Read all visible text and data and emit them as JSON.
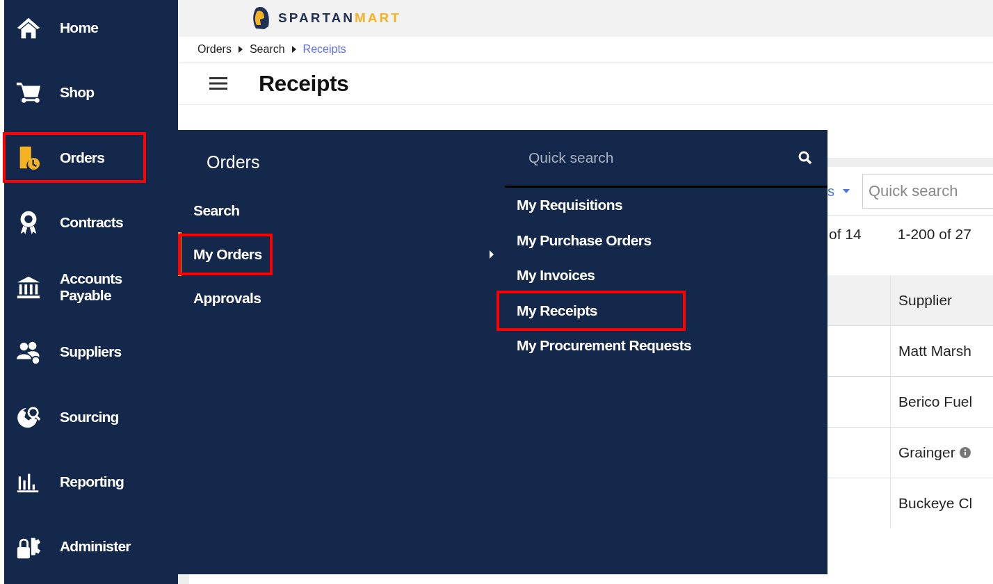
{
  "sidebar": {
    "items": [
      {
        "kind": "home",
        "label": "Home",
        "selected": false,
        "annotated": false
      },
      {
        "kind": "cart",
        "label": "Shop",
        "selected": false,
        "annotated": false
      },
      {
        "kind": "orders",
        "label": "Orders",
        "selected": true,
        "annotated": true
      },
      {
        "kind": "award",
        "label": "Contracts",
        "selected": false,
        "annotated": false
      },
      {
        "kind": "bank",
        "label": "Accounts Payable",
        "selected": false,
        "annotated": false
      },
      {
        "kind": "people",
        "label": "Suppliers",
        "selected": false,
        "annotated": false
      },
      {
        "kind": "globe",
        "label": "Sourcing",
        "selected": false,
        "annotated": false
      },
      {
        "kind": "chart",
        "label": "Reporting",
        "selected": false,
        "annotated": false
      },
      {
        "kind": "lock",
        "label": "Administer",
        "selected": false,
        "annotated": false
      }
    ]
  },
  "logo": {
    "name": "SPARTAN",
    "accent": "MART"
  },
  "breadcrumb": [
    {
      "label": "Orders",
      "current": false
    },
    {
      "label": "Search",
      "current": false
    },
    {
      "label": "Receipts",
      "current": true
    }
  ],
  "page_title": "Receipts",
  "toolbar": {
    "dropdown": "s",
    "search": {
      "placeholder": "Quick search"
    }
  },
  "counts": {
    "pages": "of 14",
    "range": "1-200 of 27"
  },
  "table": {
    "columns": [
      "Supplier"
    ],
    "rows": [
      {
        "supplier": "Matt Marsh",
        "info": false
      },
      {
        "supplier": "Berico Fuel",
        "info": false
      },
      {
        "supplier": "Grainger",
        "info": true
      },
      {
        "supplier": "Buckeye Cl",
        "info": false
      }
    ]
  },
  "flyout": {
    "title": "Orders",
    "items": [
      {
        "label": "Search",
        "selected": false,
        "annotated": false
      },
      {
        "label": "My Orders",
        "selected": true,
        "annotated": true
      },
      {
        "label": "Approvals",
        "selected": false,
        "annotated": false
      }
    ],
    "search": {
      "placeholder": "Quick search"
    },
    "subitems": [
      {
        "label": "My Requisitions",
        "annotated": false
      },
      {
        "label": "My Purchase Orders",
        "annotated": false
      },
      {
        "label": "My Invoices",
        "annotated": false
      },
      {
        "label": "My Receipts",
        "annotated": true
      },
      {
        "label": "My Procurement Requests",
        "annotated": false
      }
    ]
  }
}
